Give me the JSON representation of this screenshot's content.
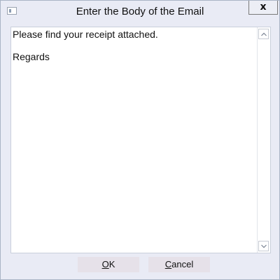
{
  "window": {
    "title": "Enter the Body of the Email",
    "close_label": "x"
  },
  "editor": {
    "lines": [
      "Please find your receipt attached.",
      "Regards"
    ]
  },
  "buttons": {
    "ok": {
      "mnemonic": "O",
      "rest": "K"
    },
    "cancel": {
      "mnemonic": "C",
      "rest": "ancel"
    }
  },
  "colors": {
    "window_bg": "#e9ebf5",
    "button_bg": "#e6e1e9",
    "border": "#a9b4c5"
  }
}
